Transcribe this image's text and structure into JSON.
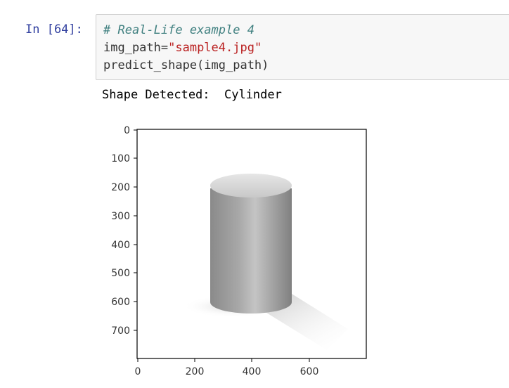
{
  "cell": {
    "prompt": "In [64]:",
    "code": {
      "comment": "# Real-Life example 4",
      "line2_var": "img_path=",
      "line2_str": "\"sample4.jpg\"",
      "line3": "predict_shape(img_path)"
    }
  },
  "output": {
    "label": "Shape Detected:  Cylinder"
  },
  "plot": {
    "y_ticks": [
      "0",
      "100",
      "200",
      "300",
      "400",
      "500",
      "600",
      "700"
    ],
    "x_ticks": [
      "0",
      "200",
      "400",
      "600"
    ],
    "colors": {
      "axis": "#000000",
      "cylinder_mid": "#9a9a9a"
    }
  }
}
